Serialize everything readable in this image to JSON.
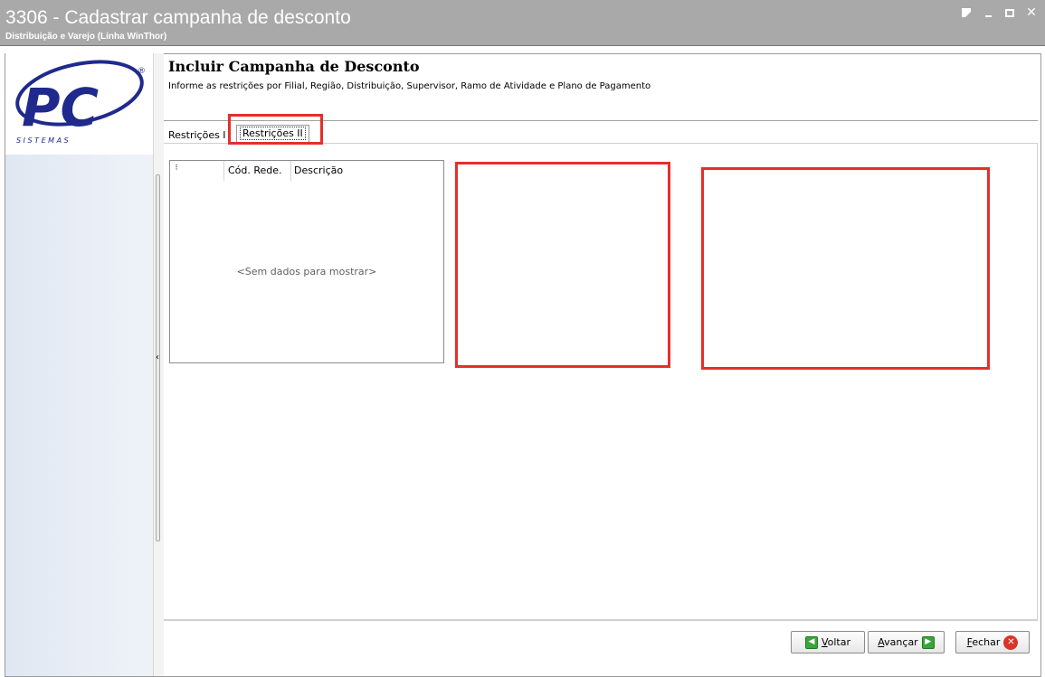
{
  "window": {
    "title": "3306 - Cadastrar campanha de desconto",
    "subtitle": "Distribuição e Varejo (Linha WinThor)"
  },
  "logo": {
    "brand": "PC",
    "tagline": "S I S T E M A S",
    "registered": "®"
  },
  "header": {
    "title": "Incluir Campanha de Desconto",
    "description": "Informe as restrições por Filial, Região, Distribuição, Supervisor, Ramo de Atividade e Plano de Pagamento"
  },
  "tabs": [
    {
      "label": "Restrições I"
    },
    {
      "label": "Restrições II",
      "active": true
    }
  ],
  "grid": {
    "columns": [
      "Cód. Rede.",
      "Descrição"
    ],
    "empty_text": "<Sem dados para mostrar>"
  },
  "buttons": {
    "back": {
      "prefix": "",
      "underline": "V",
      "rest": "oltar"
    },
    "next": {
      "prefix": "",
      "underline": "A",
      "rest": "vançar"
    },
    "close": {
      "prefix": "",
      "underline": "F",
      "rest": "echar"
    }
  },
  "colors": {
    "titlebar": "#a9a9a9",
    "highlight": "#e62e2b",
    "logo_blue": "#1f2a8c"
  }
}
